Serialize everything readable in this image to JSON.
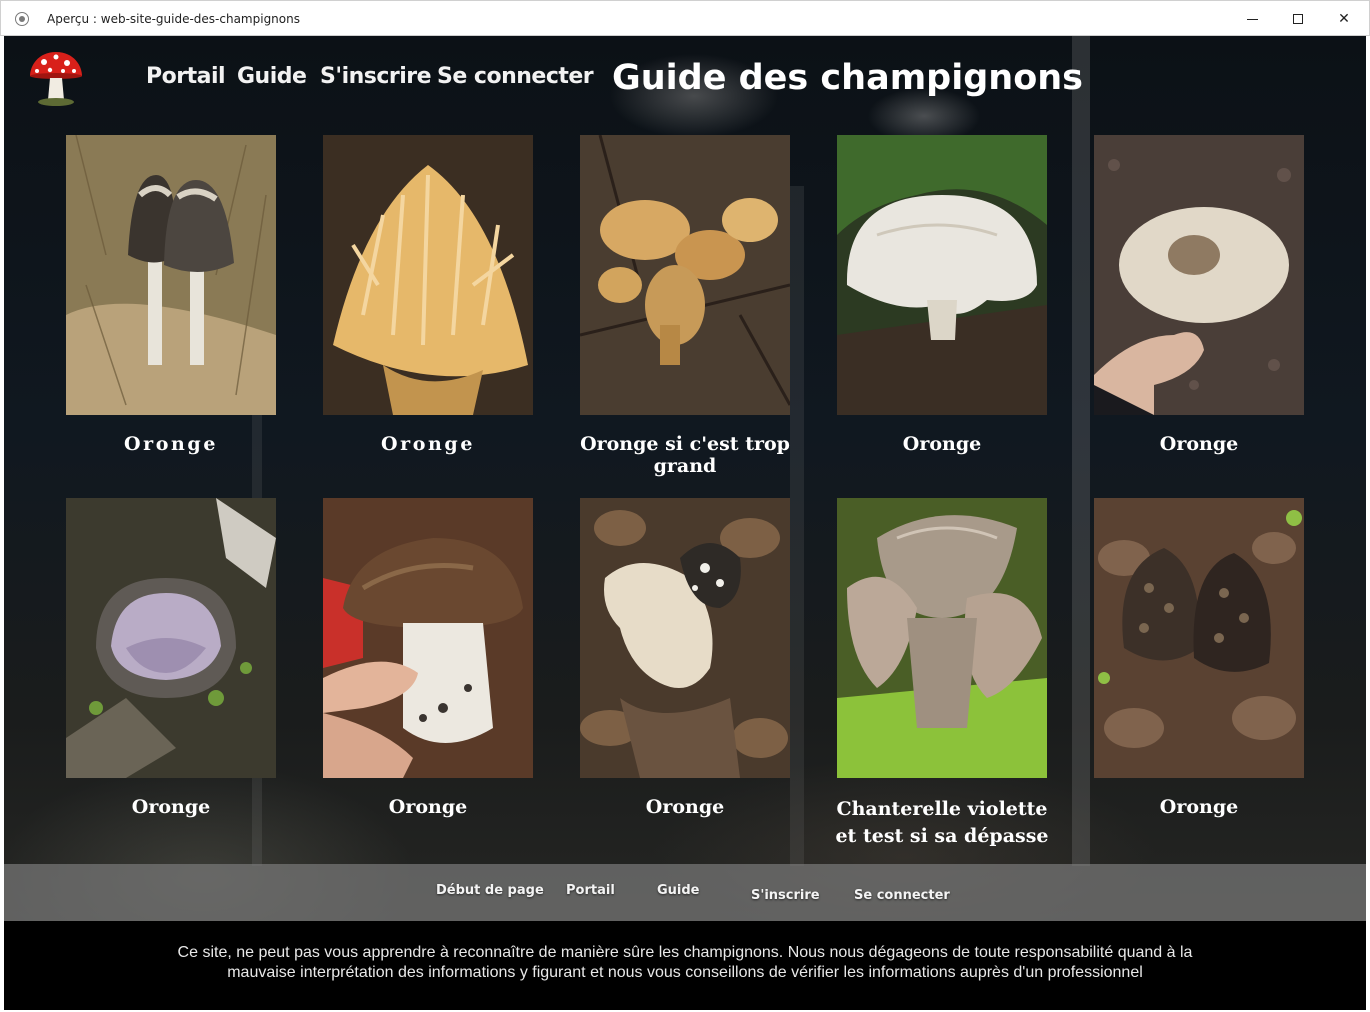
{
  "window": {
    "title": "Aperçu : web-site-guide-des-champignons",
    "close_glyph": "✕"
  },
  "header": {
    "logo": "amanita-mushroom-logo",
    "nav": [
      "Portail",
      "Guide",
      "S'inscrire",
      "Se connecter"
    ],
    "title": "Guide des champignons"
  },
  "cards": [
    {
      "caption": "Oronge",
      "image": "shaggy-ink-cap-photo"
    },
    {
      "caption": "Oronge",
      "image": "coral-fungus-photo"
    },
    {
      "caption": "Oronge si c'est trop grand",
      "image": "chanterelle-cluster-photo"
    },
    {
      "caption": "Oronge",
      "image": "white-mushroom-photo"
    },
    {
      "caption": "Oronge",
      "image": "parasol-cap-in-hand-photo"
    },
    {
      "caption": "Oronge",
      "image": "purple-cup-fungus-photo"
    },
    {
      "caption": "Oronge",
      "image": "bolete-in-hand-photo"
    },
    {
      "caption": "Oronge",
      "image": "hedgehog-mushroom-photo"
    },
    {
      "caption": "Chanterelle violette et test si sa dépasse",
      "image": "violet-chanterelle-photo"
    },
    {
      "caption": "Oronge",
      "image": "morel-photo"
    }
  ],
  "footer": {
    "links": [
      "Début de page",
      "Portail",
      "Guide",
      "S'inscrire",
      "Se connecter"
    ],
    "disclaimer": "Ce site, ne peut pas vous apprendre à reconnaître de manière sûre les champignons. Nous nous dégageons de toute responsabilité quand à la mauvaise interprétation des informations y figurant et nous vous conseillons de vérifier les informations auprès d'un professionnel"
  },
  "colors": {
    "page_background": "#0c1116",
    "footer_nav": "#787878",
    "disclaimer_bar": "#000000",
    "text": "#ffffff"
  }
}
